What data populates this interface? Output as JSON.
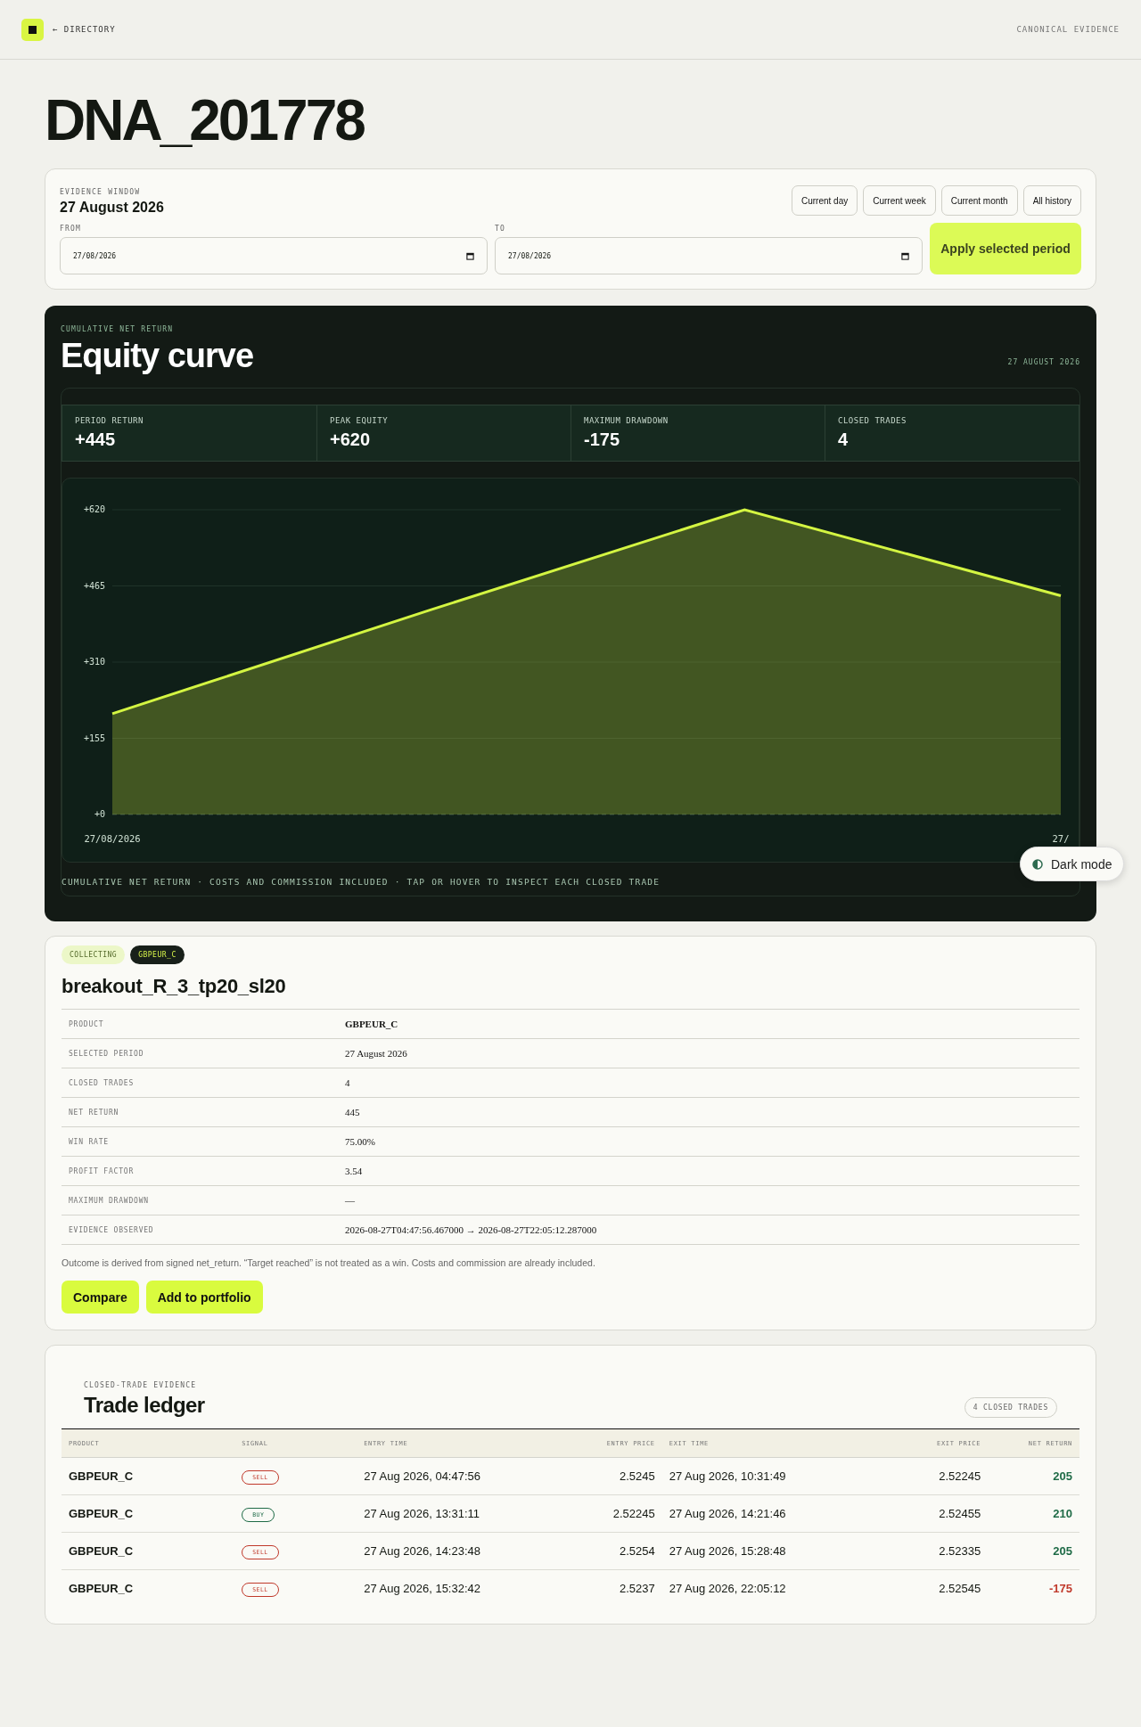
{
  "header": {
    "back_link": "← DIRECTORY",
    "right_label": "CANONICAL EVIDENCE"
  },
  "title": "DNA_201778",
  "evidence_window": {
    "label": "EVIDENCE WINDOW",
    "value": "27 August 2026",
    "presets": [
      "Current day",
      "Current week",
      "Current month",
      "All history"
    ],
    "from": {
      "label": "FROM",
      "value": "27/08/2026"
    },
    "to": {
      "label": "TO",
      "value": "27/08/2026"
    },
    "apply_button": "Apply selected period"
  },
  "equity": {
    "eyebrow": "CUMULATIVE NET RETURN",
    "title": "Equity curve",
    "date": "27 AUGUST 2026",
    "stats": [
      {
        "label": "PERIOD RETURN",
        "value": "+445"
      },
      {
        "label": "PEAK EQUITY",
        "value": "+620"
      },
      {
        "label": "MAXIMUM DRAWDOWN",
        "value": "-175"
      },
      {
        "label": "CLOSED TRADES",
        "value": "4"
      }
    ],
    "chart_data": {
      "type": "area",
      "categories": [
        "27/08/2026",
        null,
        null,
        "27/"
      ],
      "series": [
        {
          "color": "#d4f542",
          "values": [
            205,
            415,
            620,
            445
          ]
        }
      ],
      "ylim": [
        0,
        620
      ],
      "grid": true,
      "yticks": [
        {
          "value": 0,
          "label": "+0"
        },
        {
          "value": 155,
          "label": "+155"
        },
        {
          "value": 310,
          "label": "+310"
        },
        {
          "value": 465,
          "label": "+465"
        },
        {
          "value": 620,
          "label": "+620"
        }
      ]
    },
    "footnote": "CUMULATIVE NET RETURN · COSTS AND COMMISSION INCLUDED · TAP OR HOVER TO INSPECT EACH CLOSED TRADE"
  },
  "dark_mode_button": "Dark mode",
  "strategy": {
    "tags": [
      {
        "label": "COLLECTING",
        "kind": "status"
      },
      {
        "label": "GBPEUR_C",
        "kind": "product"
      }
    ],
    "name": "breakout_R_3_tp20_sl20",
    "details": [
      {
        "label": "PRODUCT",
        "value": "GBPEUR_C",
        "bold": true
      },
      {
        "label": "SELECTED PERIOD",
        "value": "27 August 2026",
        "bold": false
      },
      {
        "label": "CLOSED TRADES",
        "value": "4",
        "bold": false
      },
      {
        "label": "NET RETURN",
        "value": "445",
        "bold": false
      },
      {
        "label": "WIN RATE",
        "value": "75.00%",
        "bold": false
      },
      {
        "label": "PROFIT FACTOR",
        "value": "3.54",
        "bold": false
      },
      {
        "label": "MAXIMUM DRAWDOWN",
        "value": "—",
        "bold": false
      },
      {
        "label": "EVIDENCE OBSERVED",
        "value": "2026-08-27T04:47:56.467000 → 2026-08-27T22:05:12.287000",
        "bold": false
      }
    ],
    "note": "Outcome is derived from signed net_return. “Target reached” is not treated as a win. Costs and commission are already included.",
    "buttons": [
      "Compare",
      "Add to portfolio"
    ]
  },
  "ledger": {
    "eyebrow": "CLOSED-TRADE EVIDENCE",
    "title": "Trade ledger",
    "count_badge": "4 CLOSED TRADES",
    "columns": [
      "PRODUCT",
      "SIGNAL",
      "ENTRY TIME",
      "ENTRY PRICE",
      "EXIT TIME",
      "EXIT PRICE",
      "NET RETURN"
    ],
    "rows": [
      {
        "product": "GBPEUR_C",
        "signal": {
          "label": "SELL",
          "color": "#c0392b"
        },
        "entry_time": "27 Aug 2026, 04:47:56",
        "entry_price": "2.5245",
        "exit_time": "27 Aug 2026, 10:31:49",
        "exit_price": "2.52245",
        "net_return": {
          "value": "205",
          "color": "#1f6b47"
        }
      },
      {
        "product": "GBPEUR_C",
        "signal": {
          "label": "BUY",
          "color": "#1f6b47"
        },
        "entry_time": "27 Aug 2026, 13:31:11",
        "entry_price": "2.52245",
        "exit_time": "27 Aug 2026, 14:21:46",
        "exit_price": "2.52455",
        "net_return": {
          "value": "210",
          "color": "#1f6b47"
        }
      },
      {
        "product": "GBPEUR_C",
        "signal": {
          "label": "SELL",
          "color": "#c0392b"
        },
        "entry_time": "27 Aug 2026, 14:23:48",
        "entry_price": "2.5254",
        "exit_time": "27 Aug 2026, 15:28:48",
        "exit_price": "2.52335",
        "net_return": {
          "value": "205",
          "color": "#1f6b47"
        }
      },
      {
        "product": "GBPEUR_C",
        "signal": {
          "label": "SELL",
          "color": "#c0392b"
        },
        "entry_time": "27 Aug 2026, 15:32:42",
        "entry_price": "2.5237",
        "exit_time": "27 Aug 2026, 22:05:12",
        "exit_price": "2.52545",
        "net_return": {
          "value": "-175",
          "color": "#c0392b"
        }
      }
    ]
  }
}
